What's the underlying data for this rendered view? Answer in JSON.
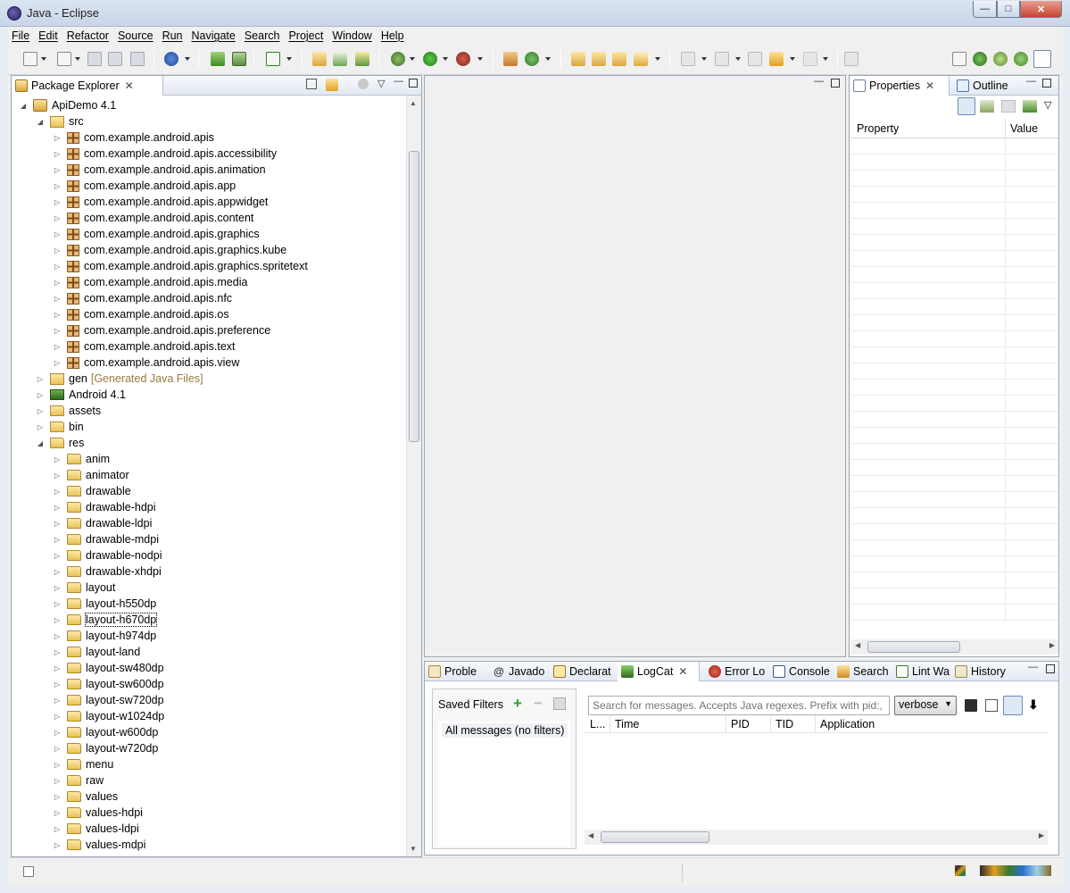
{
  "window": {
    "title": "Java - Eclipse",
    "minimize": "—",
    "maximize": "□",
    "close": "✕"
  },
  "menubar": {
    "items": [
      "File",
      "Edit",
      "Refactor",
      "Source",
      "Run",
      "Navigate",
      "Search",
      "Project",
      "Window",
      "Help"
    ]
  },
  "package_explorer": {
    "tab_label": "Package Explorer",
    "tree": [
      {
        "label": "ApiDemo 4.1",
        "level": 0,
        "expanded": true,
        "icon": "project-icon"
      },
      {
        "label": "src",
        "level": 1,
        "expanded": true,
        "icon": "source-folder-icon"
      },
      {
        "label": "com.example.android.apis",
        "level": 2,
        "icon": "package-icon"
      },
      {
        "label": "com.example.android.apis.accessibility",
        "level": 2,
        "icon": "package-icon"
      },
      {
        "label": "com.example.android.apis.animation",
        "level": 2,
        "icon": "package-icon"
      },
      {
        "label": "com.example.android.apis.app",
        "level": 2,
        "icon": "package-icon"
      },
      {
        "label": "com.example.android.apis.appwidget",
        "level": 2,
        "icon": "package-icon"
      },
      {
        "label": "com.example.android.apis.content",
        "level": 2,
        "icon": "package-icon"
      },
      {
        "label": "com.example.android.apis.graphics",
        "level": 2,
        "icon": "package-icon"
      },
      {
        "label": "com.example.android.apis.graphics.kube",
        "level": 2,
        "icon": "package-icon"
      },
      {
        "label": "com.example.android.apis.graphics.spritetext",
        "level": 2,
        "icon": "package-icon"
      },
      {
        "label": "com.example.android.apis.media",
        "level": 2,
        "icon": "package-icon"
      },
      {
        "label": "com.example.android.apis.nfc",
        "level": 2,
        "icon": "package-icon"
      },
      {
        "label": "com.example.android.apis.os",
        "level": 2,
        "icon": "package-icon"
      },
      {
        "label": "com.example.android.apis.preference",
        "level": 2,
        "icon": "package-icon"
      },
      {
        "label": "com.example.android.apis.text",
        "level": 2,
        "icon": "package-icon"
      },
      {
        "label": "com.example.android.apis.view",
        "level": 2,
        "icon": "package-icon"
      },
      {
        "label": "gen",
        "decoration": "[Generated Java Files]",
        "level": 1,
        "icon": "source-folder-icon"
      },
      {
        "label": "Android 4.1",
        "level": 1,
        "icon": "library-icon"
      },
      {
        "label": "assets",
        "level": 1,
        "icon": "folder-icon"
      },
      {
        "label": "bin",
        "level": 1,
        "icon": "folder-icon"
      },
      {
        "label": "res",
        "level": 1,
        "expanded": true,
        "icon": "folder-icon"
      },
      {
        "label": "anim",
        "level": 2,
        "icon": "folder-icon"
      },
      {
        "label": "animator",
        "level": 2,
        "icon": "folder-icon"
      },
      {
        "label": "drawable",
        "level": 2,
        "icon": "folder-icon"
      },
      {
        "label": "drawable-hdpi",
        "level": 2,
        "icon": "folder-icon"
      },
      {
        "label": "drawable-ldpi",
        "level": 2,
        "icon": "folder-icon"
      },
      {
        "label": "drawable-mdpi",
        "level": 2,
        "icon": "folder-icon"
      },
      {
        "label": "drawable-nodpi",
        "level": 2,
        "icon": "folder-icon"
      },
      {
        "label": "drawable-xhdpi",
        "level": 2,
        "icon": "folder-icon"
      },
      {
        "label": "layout",
        "level": 2,
        "icon": "folder-icon"
      },
      {
        "label": "layout-h550dp",
        "level": 2,
        "icon": "folder-icon"
      },
      {
        "label": "layout-h670dp",
        "level": 2,
        "icon": "folder-icon",
        "focused": true
      },
      {
        "label": "layout-h974dp",
        "level": 2,
        "icon": "folder-icon"
      },
      {
        "label": "layout-land",
        "level": 2,
        "icon": "folder-icon"
      },
      {
        "label": "layout-sw480dp",
        "level": 2,
        "icon": "folder-icon"
      },
      {
        "label": "layout-sw600dp",
        "level": 2,
        "icon": "folder-icon"
      },
      {
        "label": "layout-sw720dp",
        "level": 2,
        "icon": "folder-icon"
      },
      {
        "label": "layout-w1024dp",
        "level": 2,
        "icon": "folder-icon"
      },
      {
        "label": "layout-w600dp",
        "level": 2,
        "icon": "folder-icon"
      },
      {
        "label": "layout-w720dp",
        "level": 2,
        "icon": "folder-icon"
      },
      {
        "label": "menu",
        "level": 2,
        "icon": "folder-icon"
      },
      {
        "label": "raw",
        "level": 2,
        "icon": "folder-icon"
      },
      {
        "label": "values",
        "level": 2,
        "icon": "folder-icon"
      },
      {
        "label": "values-hdpi",
        "level": 2,
        "icon": "folder-icon"
      },
      {
        "label": "values-ldpi",
        "level": 2,
        "icon": "folder-icon"
      },
      {
        "label": "values-mdpi",
        "level": 2,
        "icon": "folder-icon"
      }
    ]
  },
  "properties": {
    "tabs": [
      {
        "label": "Properties",
        "active": true
      },
      {
        "label": "Outline"
      }
    ],
    "columns": [
      "Property",
      "Value"
    ]
  },
  "bottom": {
    "tabs": [
      {
        "label": "Proble",
        "icon": "problems-icon"
      },
      {
        "label": "Javado",
        "icon": "javadoc-icon"
      },
      {
        "label": "Declarat",
        "icon": "declaration-icon"
      },
      {
        "label": "LogCat",
        "icon": "logcat-icon",
        "active": true
      },
      {
        "label": "Error Lo",
        "icon": "error-log-icon"
      },
      {
        "label": "Console",
        "icon": "console-icon"
      },
      {
        "label": "Search",
        "icon": "search-icon"
      },
      {
        "label": "Lint Wa",
        "icon": "lint-icon"
      },
      {
        "label": "History",
        "icon": "history-icon"
      }
    ],
    "saved_filters_label": "Saved Filters",
    "filters": [
      "All messages (no filters)"
    ],
    "search_placeholder": "Search for messages. Accepts Java regexes. Prefix with pid:, app",
    "level": "verbose",
    "columns": [
      "L...",
      "Time",
      "PID",
      "TID",
      "Application"
    ]
  },
  "colors": {
    "accent": "#2b6fcf",
    "tab_bar": "#e3e9f2",
    "panel_border": "#9aa7b8"
  }
}
